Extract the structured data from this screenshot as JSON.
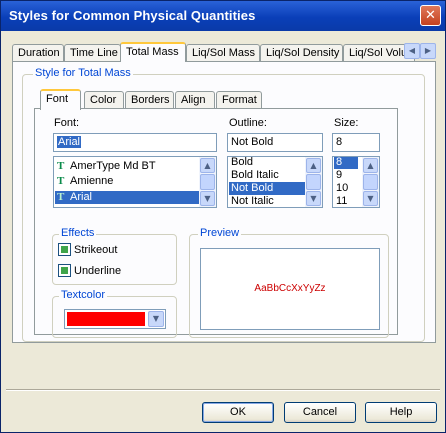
{
  "window": {
    "title": "Styles for Common Physical Quantities",
    "close_glyph": "✕"
  },
  "main_tabs": [
    "Duration",
    "Time Line",
    "Total Mass",
    "Liq/Sol Mass",
    "Liq/Sol Density",
    "Liq/Sol Volu"
  ],
  "style_group_label": "Style for Total Mass",
  "inner_tabs": [
    "Font",
    "Color",
    "Borders",
    "Align",
    "Format"
  ],
  "font": {
    "label": "Font:",
    "value": "Arial",
    "options": [
      "AmerType Md BT",
      "Amienne",
      "Arial"
    ],
    "option_icon": "truetype-font-icon",
    "selected": "Arial"
  },
  "outline": {
    "label": "Outline:",
    "value": "Not Bold",
    "options": [
      "Bold",
      "Bold Italic",
      "Not Bold",
      "Not Italic"
    ],
    "selected": "Not Bold"
  },
  "size": {
    "label": "Size:",
    "value": "8",
    "options": [
      "8",
      "9",
      "10",
      "11"
    ],
    "selected": "8"
  },
  "effects": {
    "label": "Effects",
    "strikeout_label": "Strikeout",
    "underline_label": "Underline"
  },
  "textcolor": {
    "label": "Textcolor",
    "color": "#ff0000"
  },
  "preview": {
    "label": "Preview",
    "sample_text": "AaBbCcXxYyZz",
    "text_color": "#cc0000"
  },
  "buttons": {
    "ok": "OK",
    "cancel": "Cancel",
    "help": "Help"
  },
  "colors": {
    "titlebar": "#0a3fb8",
    "selection": "#316ac5",
    "group_label": "#0046d5"
  }
}
